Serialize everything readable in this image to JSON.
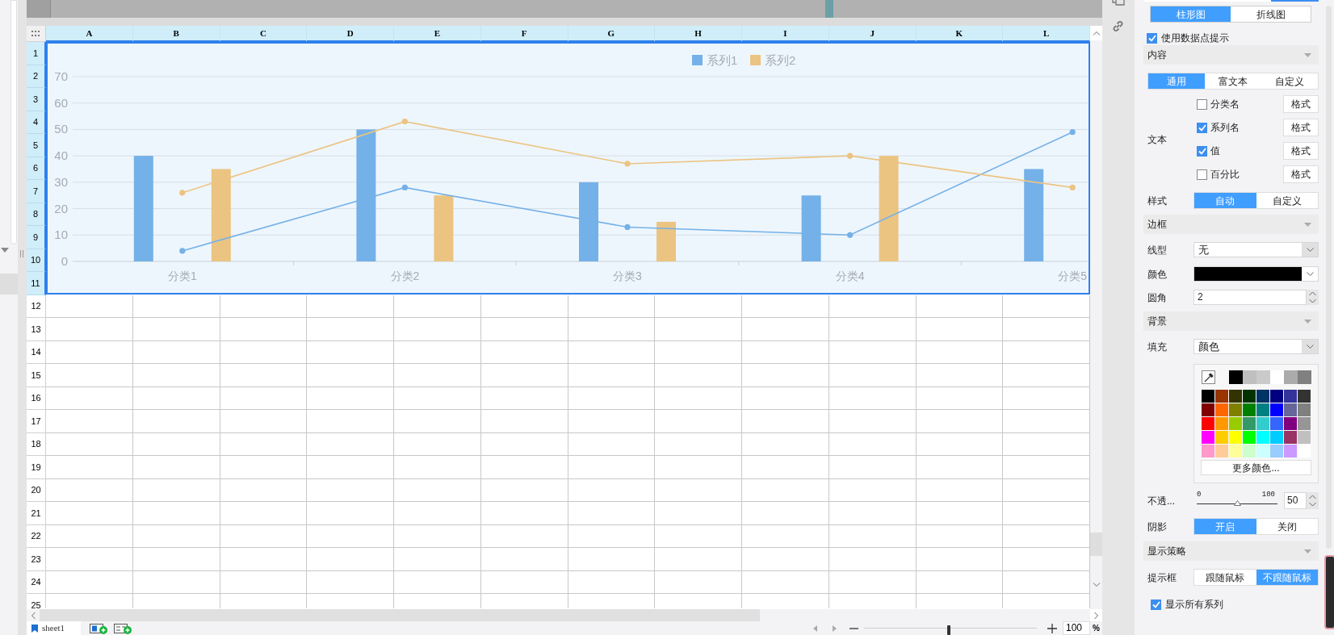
{
  "sheet": {
    "columns": [
      {
        "label": "A",
        "selected": true
      },
      {
        "label": "B",
        "selected": true
      },
      {
        "label": "C",
        "selected": true
      },
      {
        "label": "D",
        "selected": true
      },
      {
        "label": "E",
        "selected": true
      },
      {
        "label": "F",
        "selected": true
      },
      {
        "label": "G",
        "selected": true
      },
      {
        "label": "H",
        "selected": true
      },
      {
        "label": "I",
        "selected": true
      },
      {
        "label": "J",
        "selected": true
      },
      {
        "label": "K",
        "selected": true
      },
      {
        "label": "L",
        "selected": true
      }
    ],
    "rows": [
      {
        "label": "1",
        "selected": true
      },
      {
        "label": "2",
        "selected": true
      },
      {
        "label": "3",
        "selected": true
      },
      {
        "label": "4",
        "selected": true
      },
      {
        "label": "5",
        "selected": true
      },
      {
        "label": "6",
        "selected": true
      },
      {
        "label": "7",
        "selected": true
      },
      {
        "label": "8",
        "selected": true
      },
      {
        "label": "9",
        "selected": true
      },
      {
        "label": "10",
        "selected": true
      },
      {
        "label": "11",
        "selected": true
      },
      {
        "label": "12",
        "selected": false
      },
      {
        "label": "13",
        "selected": false
      },
      {
        "label": "14",
        "selected": false
      },
      {
        "label": "15",
        "selected": false
      },
      {
        "label": "16",
        "selected": false
      },
      {
        "label": "17",
        "selected": false
      },
      {
        "label": "18",
        "selected": false
      },
      {
        "label": "19",
        "selected": false
      },
      {
        "label": "20",
        "selected": false
      },
      {
        "label": "21",
        "selected": false
      },
      {
        "label": "22",
        "selected": false
      },
      {
        "label": "23",
        "selected": false
      },
      {
        "label": "24",
        "selected": false
      },
      {
        "label": "25",
        "selected": false
      }
    ]
  },
  "chart": {
    "chart_data": {
      "type": "bar",
      "grid": true,
      "legend": true,
      "categories": [
        "分类1",
        "分类2",
        "分类3",
        "分类4",
        "分类5"
      ],
      "ylim": [
        0,
        70
      ],
      "yticks": [
        0,
        10,
        20,
        30,
        40,
        50,
        60,
        70
      ],
      "series": [
        {
          "name": "系列1",
          "color": "#74b1e8",
          "values": [
            40,
            50,
            30,
            25,
            35
          ]
        },
        {
          "name": "系列2",
          "color": "#ebc482",
          "values": [
            35,
            25,
            15,
            40,
            null
          ]
        },
        {
          "type": "line",
          "marker": true,
          "color": "#74b1e8",
          "values": [
            4,
            28,
            13,
            10,
            49
          ]
        },
        {
          "type": "line",
          "marker": true,
          "color": "#ebc482",
          "values": [
            26,
            53,
            37,
            40,
            28
          ]
        }
      ]
    }
  },
  "sheet_tabs": [
    {
      "label": "sheet1",
      "selected": true
    }
  ],
  "zoom_control": {
    "level": 0.49,
    "value": "100",
    "unit": "%"
  },
  "panel": {
    "chart_type_tabs": [
      {
        "label": "柱形图",
        "selected": true
      },
      {
        "label": "折线图",
        "selected": false
      }
    ],
    "use_tooltip": {
      "label": "使用数据点提示",
      "checked": true
    },
    "content_section": {
      "title": "内容",
      "mode_tabs": [
        {
          "label": "通用",
          "selected": true
        },
        {
          "label": "富文本",
          "selected": false
        },
        {
          "label": "自定义",
          "selected": false
        }
      ],
      "text_label": "文本",
      "text_items": [
        {
          "label": "分类名",
          "checked": false,
          "button": "格式"
        },
        {
          "label": "系列名",
          "checked": true,
          "button": "格式"
        },
        {
          "label": "值",
          "checked": true,
          "button": "格式"
        },
        {
          "label": "百分比",
          "checked": false,
          "button": "格式"
        }
      ],
      "style": {
        "label": "样式",
        "options": [
          {
            "label": "自动",
            "selected": true
          },
          {
            "label": "自定义",
            "selected": false
          }
        ]
      }
    },
    "border_section": {
      "title": "边框",
      "line_type": {
        "label": "线型",
        "value": "无"
      },
      "color": {
        "label": "颜色",
        "color": "#000000"
      },
      "radius": {
        "label": "圆角",
        "value": "2"
      }
    },
    "background_section": {
      "title": "背景",
      "fill": {
        "label": "填充",
        "value": "颜色"
      },
      "recent_colors": [
        {
          "color": "#000000"
        },
        {
          "color": "#bfbfbf"
        },
        {
          "color": "#cacaca"
        },
        {
          "color": "#ffffff"
        },
        {
          "color": "#ababab"
        },
        {
          "color": "#808080"
        }
      ],
      "palette": [
        {
          "color": "#000000"
        },
        {
          "color": "#993300"
        },
        {
          "color": "#333300"
        },
        {
          "color": "#003300"
        },
        {
          "color": "#003366"
        },
        {
          "color": "#000080"
        },
        {
          "color": "#333399"
        },
        {
          "color": "#333333"
        },
        {
          "color": "#800000"
        },
        {
          "color": "#ff6600"
        },
        {
          "color": "#808000"
        },
        {
          "color": "#008000"
        },
        {
          "color": "#008080"
        },
        {
          "color": "#0000ff"
        },
        {
          "color": "#666699"
        },
        {
          "color": "#808080"
        },
        {
          "color": "#ff0000"
        },
        {
          "color": "#ff9900"
        },
        {
          "color": "#99cc00"
        },
        {
          "color": "#339966"
        },
        {
          "color": "#33cccc"
        },
        {
          "color": "#3366ff"
        },
        {
          "color": "#800080"
        },
        {
          "color": "#969696"
        },
        {
          "color": "#ff00ff"
        },
        {
          "color": "#ffcc00"
        },
        {
          "color": "#ffff00"
        },
        {
          "color": "#00ff00"
        },
        {
          "color": "#00ffff"
        },
        {
          "color": "#00ccff"
        },
        {
          "color": "#993366"
        },
        {
          "color": "#c0c0c0"
        },
        {
          "color": "#ff99cc"
        },
        {
          "color": "#ffcc99"
        },
        {
          "color": "#ffff99"
        },
        {
          "color": "#ccffcc"
        },
        {
          "color": "#ccffff"
        },
        {
          "color": "#99ccff"
        },
        {
          "color": "#cc99ff"
        },
        {
          "color": "#ffffff"
        }
      ],
      "more_colors_button": "更多颜色...",
      "opacity": {
        "label": "不透...",
        "min": "0",
        "max": "100",
        "level": 0.5,
        "value": "50"
      },
      "shadow": {
        "label": "阴影",
        "options": [
          {
            "label": "开启",
            "selected": true
          },
          {
            "label": "关闭",
            "selected": false
          }
        ]
      }
    },
    "display_section": {
      "title": "显示策略",
      "tooltip": {
        "label": "提示框",
        "options": [
          {
            "label": "跟随鼠标",
            "selected": false
          },
          {
            "label": "不跟随鼠标",
            "selected": true
          }
        ]
      },
      "show_all_series": {
        "label": "显示所有系列",
        "checked": true
      }
    }
  }
}
